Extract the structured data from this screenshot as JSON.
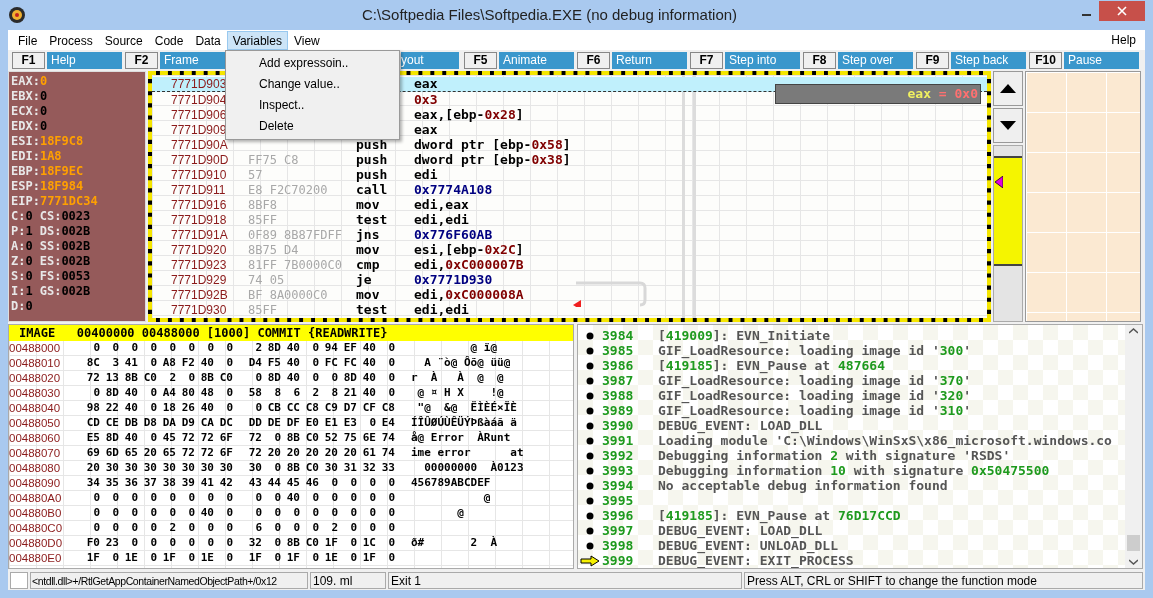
{
  "window": {
    "title": "C:\\Softpedia Files\\Softpedia.EXE (no debug information)"
  },
  "menu": [
    {
      "label": "File",
      "selected": false
    },
    {
      "label": "Process",
      "selected": false
    },
    {
      "label": "Source",
      "selected": false
    },
    {
      "label": "Code",
      "selected": false
    },
    {
      "label": "Data",
      "selected": false
    },
    {
      "label": "Variables",
      "selected": true
    },
    {
      "label": "View",
      "selected": false
    }
  ],
  "help_menu": "Help",
  "dropdown": [
    "Add expressoin..",
    "Change value..",
    "Inspect..",
    "Delete"
  ],
  "function_keys": [
    {
      "kind": "key",
      "key": "F1",
      "label": "Help"
    },
    {
      "kind": "key",
      "key": "F2",
      "label": "Frame"
    },
    {
      "kind": "partial",
      "label": "yout"
    },
    {
      "kind": "key",
      "key": "F5",
      "label": "Animate"
    },
    {
      "kind": "key",
      "key": "F6",
      "label": "Return"
    },
    {
      "kind": "key",
      "key": "F7",
      "label": "Step into"
    },
    {
      "kind": "key",
      "key": "F8",
      "label": "Step over"
    },
    {
      "kind": "key",
      "key": "F9",
      "label": "Step back"
    },
    {
      "kind": "key",
      "key": "F10",
      "label": "Pause"
    }
  ],
  "registers": [
    [
      {
        "name": "EAX:",
        "value": "0",
        "changed": true
      }
    ],
    [
      {
        "name": "EBX:",
        "value": "0",
        "changed": false
      }
    ],
    [
      {
        "name": "ECX:",
        "value": "0",
        "changed": false
      }
    ],
    [
      {
        "name": "EDX:",
        "value": "0",
        "changed": false
      }
    ],
    [
      {
        "name": "ESI:",
        "value": "18F9C8",
        "changed": true
      }
    ],
    [
      {
        "name": "EDI:",
        "value": "1A8",
        "changed": true
      }
    ],
    [
      {
        "name": "EBP:",
        "value": "18F9EC",
        "changed": true
      }
    ],
    [
      {
        "name": "ESP:",
        "value": "18F984",
        "changed": true
      }
    ],
    [
      {
        "name": "EIP:",
        "value": "7771DC34",
        "changed": true
      }
    ],
    [
      {
        "name": "C:",
        "value": "0",
        "changed": false
      },
      {
        "name": "CS:",
        "value": "0023",
        "changed": false
      }
    ],
    [
      {
        "name": "P:",
        "value": "1",
        "changed": false
      },
      {
        "name": "DS:",
        "value": "002B",
        "changed": false
      }
    ],
    [
      {
        "name": "A:",
        "value": "0",
        "changed": false
      },
      {
        "name": "SS:",
        "value": "002B",
        "changed": false
      }
    ],
    [
      {
        "name": "Z:",
        "value": "0",
        "changed": false
      },
      {
        "name": "ES:",
        "value": "002B",
        "changed": false
      }
    ],
    [
      {
        "name": "S:",
        "value": "0",
        "changed": false
      },
      {
        "name": "FS:",
        "value": "0053",
        "changed": false
      }
    ],
    [
      {
        "name": "I:",
        "value": "1",
        "changed": false
      },
      {
        "name": "GS:",
        "value": "002B",
        "changed": false
      }
    ],
    [
      {
        "name": "D:",
        "value": "0",
        "changed": false
      }
    ]
  ],
  "disassembly": [
    {
      "address": "7771D903",
      "selected": true,
      "operand": [
        {
          "text": "eax",
          "kind": "plain"
        }
      ]
    },
    {
      "address": "7771D904",
      "selected": false,
      "operand": [
        {
          "text": "0x3",
          "kind": "imm"
        }
      ]
    },
    {
      "address": "7771D906",
      "selected": false,
      "operand": [
        {
          "text": "eax,[ebp-",
          "kind": "plain"
        },
        {
          "text": "0x28",
          "kind": "imm"
        },
        {
          "text": "]",
          "kind": "plain"
        }
      ]
    },
    {
      "address": "7771D909",
      "selected": false,
      "operand": [
        {
          "text": "eax",
          "kind": "plain"
        }
      ]
    },
    {
      "address": "7771D90A",
      "selected": false,
      "mnemonic": "push",
      "operand": [
        {
          "text": "dword ptr [ebp-",
          "kind": "plain"
        },
        {
          "text": "0x58",
          "kind": "imm"
        },
        {
          "text": "]",
          "kind": "plain"
        }
      ]
    },
    {
      "address": "7771D90D",
      "selected": false,
      "bytes": "FF75 C8",
      "mnemonic": "push",
      "operand": [
        {
          "text": "dword ptr [ebp-",
          "kind": "plain"
        },
        {
          "text": "0x38",
          "kind": "imm"
        },
        {
          "text": "]",
          "kind": "plain"
        }
      ]
    },
    {
      "address": "7771D910",
      "selected": false,
      "bytes": "57",
      "mnemonic": "push",
      "operand": [
        {
          "text": "edi",
          "kind": "plain"
        }
      ]
    },
    {
      "address": "7771D911",
      "selected": false,
      "bytes": "E8 F2C70200",
      "mnemonic": "call",
      "operand": [
        {
          "text": "0x7774A108",
          "kind": "addr"
        }
      ]
    },
    {
      "address": "7771D916",
      "selected": false,
      "bytes": "8BF8",
      "mnemonic": "mov",
      "operand": [
        {
          "text": "edi,eax",
          "kind": "plain"
        }
      ]
    },
    {
      "address": "7771D918",
      "selected": false,
      "bytes": "85FF",
      "mnemonic": "test",
      "operand": [
        {
          "text": "edi,edi",
          "kind": "plain"
        }
      ]
    },
    {
      "address": "7771D91A",
      "selected": false,
      "bytes": "0F89 8B87FDFF",
      "mnemonic": "jns",
      "operand": [
        {
          "text": "0x776F60AB",
          "kind": "addr"
        }
      ]
    },
    {
      "address": "7771D920",
      "selected": false,
      "bytes": "8B75 D4",
      "mnemonic": "mov",
      "operand": [
        {
          "text": "esi,[ebp-",
          "kind": "plain"
        },
        {
          "text": "0x2C",
          "kind": "imm"
        },
        {
          "text": "]",
          "kind": "plain"
        }
      ]
    },
    {
      "address": "7771D923",
      "selected": false,
      "bytes": "81FF 7B0000C0",
      "mnemonic": "cmp",
      "operand": [
        {
          "text": "edi,",
          "kind": "plain"
        },
        {
          "text": "0xC000007B",
          "kind": "imm"
        }
      ]
    },
    {
      "address": "7771D929",
      "selected": false,
      "bytes": "74 05",
      "mnemonic": "je",
      "operand": [
        {
          "text": "0x7771D930",
          "kind": "addr"
        }
      ]
    },
    {
      "address": "7771D92B",
      "selected": false,
      "bytes": "BF 8A0000C0",
      "mnemonic": "mov",
      "operand": [
        {
          "text": "edi,",
          "kind": "plain"
        },
        {
          "text": "0xC000008A",
          "kind": "imm"
        }
      ]
    },
    {
      "address": "7771D930",
      "selected": false,
      "bytes": "85FF",
      "mnemonic": "test",
      "operand": [
        {
          "text": "edi,edi",
          "kind": "plain"
        }
      ]
    }
  ],
  "watch_tooltip": {
    "name": "eax",
    "value": "= 0x0"
  },
  "memory": {
    "header": "IMAGE   00400000 00488000 [1000] COMMIT {READWRITE}",
    "rows": [
      {
        "address": "00488000",
        "bytes": [
          "0",
          "0",
          "0",
          "0",
          "0",
          "0",
          "0",
          "0",
          "2",
          "8D",
          "40",
          "0",
          "94",
          "EF",
          "40",
          "0"
        ],
        "ascii": "         @ ï@"
      },
      {
        "address": "00488010",
        "bytes": [
          "8C",
          "3",
          "41",
          "0",
          "A8",
          "F2",
          "40",
          "0",
          "D4",
          "F5",
          "40",
          "0",
          "FC",
          "FC",
          "40",
          "0"
        ],
        "ascii": "  A ¨ò@ Ôõ@ üü@"
      },
      {
        "address": "00488020",
        "bytes": [
          "72",
          "13",
          "8B",
          "C0",
          "2",
          "0",
          "8B",
          "C0",
          "0",
          "8D",
          "40",
          "0",
          "0",
          "8D",
          "40",
          "0"
        ],
        "ascii": "r  À   À  @  @"
      },
      {
        "address": "00488030",
        "bytes": [
          "0",
          "8D",
          "40",
          "0",
          "A4",
          "80",
          "48",
          "0",
          "58",
          "8",
          "6",
          "2",
          "8",
          "21",
          "40",
          "0"
        ],
        "ascii": " @ ¤ H X    !@"
      },
      {
        "address": "00488040",
        "bytes": [
          "98",
          "22",
          "40",
          "0",
          "18",
          "26",
          "40",
          "0",
          "0",
          "CB",
          "CC",
          "C8",
          "C9",
          "D7",
          "CF",
          "C8"
        ],
        "ascii": " \"@  &@  ËÌÈÉ×ÏÈ"
      },
      {
        "address": "00488050",
        "bytes": [
          "CD",
          "CE",
          "DB",
          "D8",
          "DA",
          "D9",
          "CA",
          "DC",
          "DD",
          "DE",
          "DF",
          "E0",
          "E1",
          "E3",
          "0",
          "E4"
        ],
        "ascii": "ÍÎÛØÚÙÊÜÝÞßàáã ä"
      },
      {
        "address": "00488060",
        "bytes": [
          "E5",
          "8D",
          "40",
          "0",
          "45",
          "72",
          "72",
          "6F",
          "72",
          "0",
          "8B",
          "C0",
          "52",
          "75",
          "6E",
          "74"
        ],
        "ascii": "å@ Error  ÀRunt"
      },
      {
        "address": "00488070",
        "bytes": [
          "69",
          "6D",
          "65",
          "20",
          "65",
          "72",
          "72",
          "6F",
          "72",
          "20",
          "20",
          "20",
          "20",
          "20",
          "61",
          "74"
        ],
        "ascii": "ime error      at"
      },
      {
        "address": "00488080",
        "bytes": [
          "20",
          "30",
          "30",
          "30",
          "30",
          "30",
          "30",
          "30",
          "30",
          "0",
          "8B",
          "C0",
          "30",
          "31",
          "32",
          "33"
        ],
        "ascii": "  00000000  À0123"
      },
      {
        "address": "00488090",
        "bytes": [
          "34",
          "35",
          "36",
          "37",
          "38",
          "39",
          "41",
          "42",
          "43",
          "44",
          "45",
          "46",
          "0",
          "0",
          "0",
          "0"
        ],
        "ascii": "456789ABCDEF"
      },
      {
        "address": "004880A0",
        "bytes": [
          "0",
          "0",
          "0",
          "0",
          "0",
          "0",
          "0",
          "0",
          "0",
          "0",
          "40",
          "0",
          "0",
          "0",
          "0",
          "0"
        ],
        "ascii": "           @"
      },
      {
        "address": "004880B0",
        "bytes": [
          "0",
          "0",
          "0",
          "0",
          "0",
          "0",
          "40",
          "0",
          "0",
          "0",
          "0",
          "0",
          "0",
          "0",
          "0",
          "0"
        ],
        "ascii": "       @"
      },
      {
        "address": "004880C0",
        "bytes": [
          "0",
          "0",
          "0",
          "0",
          "2",
          "0",
          "0",
          "0",
          "6",
          "0",
          "0",
          "0",
          "2",
          "0",
          "0",
          "0"
        ]
      },
      {
        "address": "004880D0",
        "bytes": [
          "F0",
          "23",
          "0",
          "0",
          "0",
          "0",
          "0",
          "0",
          "32",
          "0",
          "8B",
          "C0",
          "1F",
          "0",
          "1C",
          "0"
        ],
        "ascii": "ð#       2  À"
      },
      {
        "address": "004880E0",
        "bytes": [
          "1F",
          "0",
          "1E",
          "0",
          "1F",
          "0",
          "1E",
          "0",
          "1F",
          "0",
          "1F",
          "0",
          "1E",
          "0",
          "1F",
          "0"
        ]
      }
    ]
  },
  "log": [
    {
      "number": "3984",
      "kind": "bullet",
      "segments": [
        {
          "text": "[",
          "kind": "text"
        },
        {
          "text": "419009",
          "kind": "num"
        },
        {
          "text": "]: EVN_Initiate",
          "kind": "text"
        }
      ]
    },
    {
      "number": "3985",
      "kind": "bullet",
      "segments": [
        {
          "text": "GIF_LoadResource: loading image id '",
          "kind": "text"
        },
        {
          "text": "300",
          "kind": "num"
        },
        {
          "text": "'",
          "kind": "text"
        }
      ]
    },
    {
      "number": "3986",
      "kind": "bullet",
      "segments": [
        {
          "text": "[",
          "kind": "text"
        },
        {
          "text": "419185",
          "kind": "num"
        },
        {
          "text": "]: EVN_Pause at ",
          "kind": "text"
        },
        {
          "text": "487664",
          "kind": "num"
        }
      ]
    },
    {
      "number": "3987",
      "kind": "bullet",
      "segments": [
        {
          "text": "GIF_LoadResource: loading image id '",
          "kind": "text"
        },
        {
          "text": "370",
          "kind": "num"
        },
        {
          "text": "'",
          "kind": "text"
        }
      ]
    },
    {
      "number": "3988",
      "kind": "bullet",
      "segments": [
        {
          "text": "GIF_LoadResource: loading image id '",
          "kind": "text"
        },
        {
          "text": "320",
          "kind": "num"
        },
        {
          "text": "'",
          "kind": "text"
        }
      ]
    },
    {
      "number": "3989",
      "kind": "bullet",
      "segments": [
        {
          "text": "GIF_LoadResource: loading image id '",
          "kind": "text"
        },
        {
          "text": "310",
          "kind": "num"
        },
        {
          "text": "'",
          "kind": "text"
        }
      ]
    },
    {
      "number": "3990",
      "kind": "bullet",
      "segments": [
        {
          "text": "DEBUG_EVENT: LOAD_DLL",
          "kind": "text"
        }
      ]
    },
    {
      "number": "3991",
      "kind": "bullet",
      "segments": [
        {
          "text": "Loading module 'C:\\Windows\\WinSxS\\x86_microsoft.windows.co",
          "kind": "text"
        }
      ]
    },
    {
      "number": "3992",
      "kind": "bullet",
      "segments": [
        {
          "text": "Debugging information ",
          "kind": "text"
        },
        {
          "text": "2",
          "kind": "num"
        },
        {
          "text": " with signature 'RSDS'",
          "kind": "text"
        }
      ]
    },
    {
      "number": "3993",
      "kind": "bullet",
      "segments": [
        {
          "text": "Debugging information ",
          "kind": "text"
        },
        {
          "text": "10",
          "kind": "num"
        },
        {
          "text": " with signature ",
          "kind": "text"
        },
        {
          "text": "0x50475500",
          "kind": "num"
        }
      ]
    },
    {
      "number": "3994",
      "kind": "bullet",
      "segments": [
        {
          "text": "No acceptable debug information found",
          "kind": "text"
        }
      ]
    },
    {
      "number": "3995",
      "kind": "bullet"
    },
    {
      "number": "3996",
      "kind": "bullet",
      "segments": [
        {
          "text": "[",
          "kind": "text"
        },
        {
          "text": "419185",
          "kind": "num"
        },
        {
          "text": "]: EVN_Pause at ",
          "kind": "text"
        },
        {
          "text": "76D17CCD",
          "kind": "num"
        }
      ]
    },
    {
      "number": "3997",
      "kind": "bullet",
      "segments": [
        {
          "text": "DEBUG_EVENT: LOAD_DLL",
          "kind": "text"
        }
      ]
    },
    {
      "number": "3998",
      "kind": "bullet",
      "segments": [
        {
          "text": "DEBUG_EVENT: UNLOAD_DLL",
          "kind": "text"
        }
      ]
    },
    {
      "number": "3999",
      "kind": "current",
      "segments": [
        {
          "text": "DEBUG_EVENT: EXIT_PROCESS",
          "kind": "text"
        }
      ]
    }
  ],
  "status_bar": {
    "location": "<ntdll.dll>+/RtlGetAppContainerNamedObjectPath+/0x12",
    "position": "109. ml",
    "state": "Exit 1",
    "hint": "Press ALT, CRL or SHIFT to change the function mode"
  }
}
